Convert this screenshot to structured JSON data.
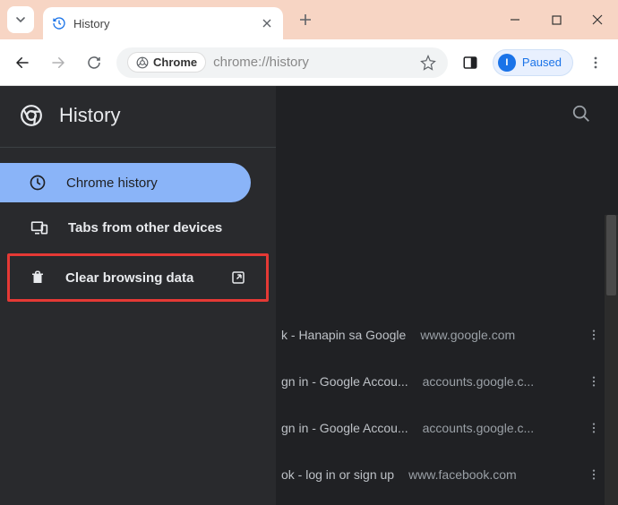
{
  "tab": {
    "title": "History"
  },
  "omnibox": {
    "chip": "Chrome",
    "url": "chrome://history"
  },
  "profile": {
    "initial": "I",
    "label": "Paused"
  },
  "sidebar": {
    "title": "History",
    "items": [
      {
        "label": "Chrome history"
      },
      {
        "label": "Tabs from other devices"
      },
      {
        "label": "Clear browsing data"
      }
    ]
  },
  "history_rows": [
    {
      "title": "k - Hanapin sa Google",
      "domain": "www.google.com"
    },
    {
      "title": "gn in - Google Accou...",
      "domain": "accounts.google.c..."
    },
    {
      "title": "gn in - Google Accou...",
      "domain": "accounts.google.c..."
    },
    {
      "title": "ok - log in or sign up",
      "domain": "www.facebook.com"
    }
  ]
}
